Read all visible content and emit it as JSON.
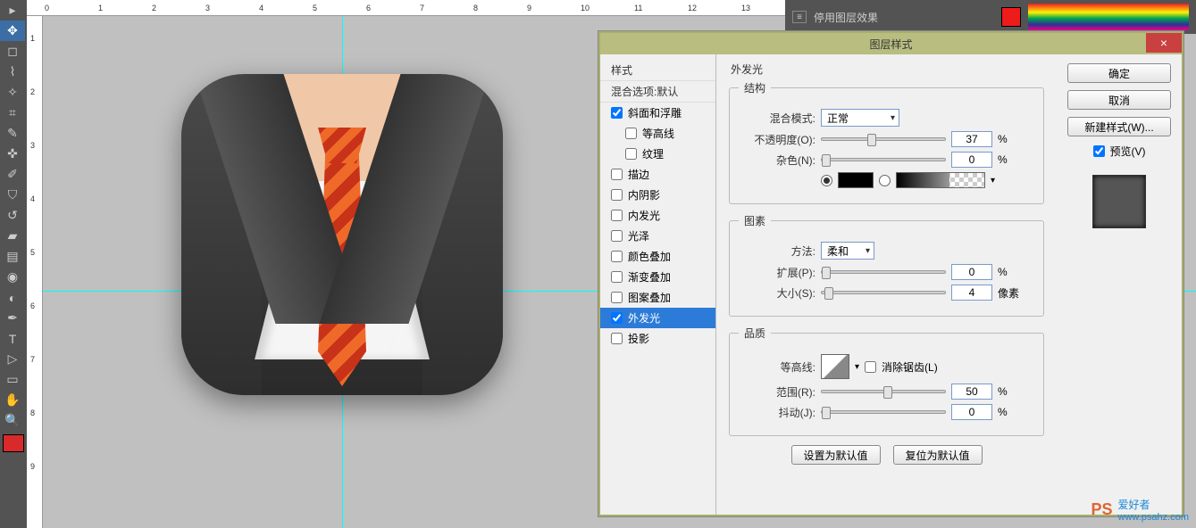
{
  "top_bar": {
    "menu_label": "停用图层效果"
  },
  "ruler": {
    "h": [
      "0",
      "1",
      "2",
      "3",
      "4",
      "5",
      "6",
      "7",
      "8",
      "9",
      "10",
      "11",
      "12",
      "13"
    ],
    "v": [
      "1",
      "2",
      "3",
      "4",
      "5",
      "6",
      "7",
      "8",
      "9"
    ]
  },
  "dialog": {
    "title": "图层样式",
    "close": "×",
    "styles": {
      "header": "样式",
      "blend": "混合选项:默认",
      "items": [
        {
          "label": "斜面和浮雕",
          "checked": true,
          "indent": false
        },
        {
          "label": "等高线",
          "checked": false,
          "indent": true
        },
        {
          "label": "纹理",
          "checked": false,
          "indent": true
        },
        {
          "label": "描边",
          "checked": false,
          "indent": false
        },
        {
          "label": "内阴影",
          "checked": false,
          "indent": false
        },
        {
          "label": "内发光",
          "checked": false,
          "indent": false
        },
        {
          "label": "光泽",
          "checked": false,
          "indent": false
        },
        {
          "label": "颜色叠加",
          "checked": false,
          "indent": false
        },
        {
          "label": "渐变叠加",
          "checked": false,
          "indent": false
        },
        {
          "label": "图案叠加",
          "checked": false,
          "indent": false
        },
        {
          "label": "外发光",
          "checked": true,
          "indent": false,
          "selected": true
        },
        {
          "label": "投影",
          "checked": false,
          "indent": false
        }
      ]
    },
    "settings": {
      "section_title": "外发光",
      "structure": {
        "legend": "结构",
        "blend_label": "混合模式:",
        "blend_value": "正常",
        "opacity_label": "不透明度(O):",
        "opacity_value": "37",
        "opacity_unit": "%",
        "noise_label": "杂色(N):",
        "noise_value": "0",
        "noise_unit": "%"
      },
      "elements": {
        "legend": "图素",
        "method_label": "方法:",
        "method_value": "柔和",
        "spread_label": "扩展(P):",
        "spread_value": "0",
        "spread_unit": "%",
        "size_label": "大小(S):",
        "size_value": "4",
        "size_unit": "像素"
      },
      "quality": {
        "legend": "品质",
        "contour_label": "等高线:",
        "antialias_label": "消除锯齿(L)",
        "range_label": "范围(R):",
        "range_value": "50",
        "range_unit": "%",
        "jitter_label": "抖动(J):",
        "jitter_value": "0",
        "jitter_unit": "%"
      },
      "reset": {
        "make_default": "设置为默认值",
        "reset_default": "复位为默认值"
      }
    },
    "actions": {
      "ok": "确定",
      "cancel": "取消",
      "new_style": "新建样式(W)...",
      "preview": "预览(V)"
    }
  },
  "watermark": {
    "brand": "PS",
    "text": "爱好者",
    "url": "www.psahz.com"
  }
}
